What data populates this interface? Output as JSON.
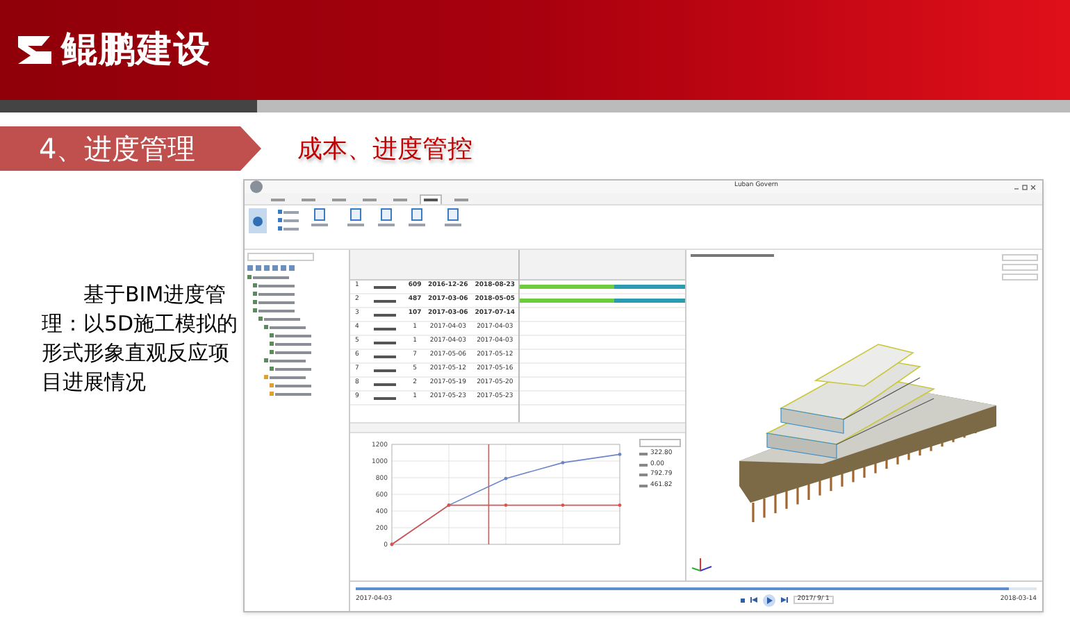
{
  "header": {
    "logo": "鲲鹏建设"
  },
  "section": {
    "title": "4、进度管理",
    "subtitle": "成本、进度管控"
  },
  "description": "基于BIM进度管理：以5D施工模拟的形式形象直观反应项目进展情况",
  "app": {
    "title": "Luban Govern",
    "checkboxes": [
      {
        "checked": true
      },
      {
        "checked": true
      },
      {
        "checked": true
      }
    ],
    "tabs": [
      {
        "selected": false
      },
      {
        "selected": false
      },
      {
        "selected": false
      },
      {
        "selected": false
      },
      {
        "selected": false
      },
      {
        "selected": true
      },
      {
        "selected": false
      }
    ],
    "gantt": {
      "rows": [
        {
          "number": "1",
          "duration": "609",
          "start": "2016-12-26",
          "end": "2018-08-23",
          "level": 0.57
        },
        {
          "number": "2",
          "duration": "487",
          "start": "2017-03-06",
          "end": "2018-05-05",
          "level": 0.57
        },
        {
          "number": "3",
          "duration": "107",
          "start": "2017-03-06",
          "end": "2017-07-14"
        },
        {
          "number": "4",
          "duration": "1",
          "start": "2017-04-03",
          "end": "2017-04-03"
        },
        {
          "number": "5",
          "duration": "1",
          "start": "2017-04-03",
          "end": "2017-04-03"
        },
        {
          "number": "6",
          "duration": "7",
          "start": "2017-05-06",
          "end": "2017-05-12"
        },
        {
          "number": "7",
          "duration": "5",
          "start": "2017-05-12",
          "end": "2017-05-16"
        },
        {
          "number": "8",
          "duration": "2",
          "start": "2017-05-19",
          "end": "2017-05-20"
        },
        {
          "number": "9",
          "duration": "1",
          "start": "2017-05-23",
          "end": "2017-05-23"
        }
      ]
    },
    "chart": {
      "chart_data": {
        "type": "line",
        "ylim": [
          0,
          1200
        ],
        "yticks": [
          0,
          200,
          400,
          600,
          800,
          1000,
          1200
        ],
        "grid": true,
        "series": [
          {
            "color": "#6b86c8",
            "values": [
              0,
              470,
              790,
              980,
              1080
            ]
          },
          {
            "color": "#d9534f",
            "values": [
              0,
              470,
              470,
              470,
              470
            ]
          }
        ]
      },
      "readings": [
        "322.80",
        "0.00",
        "792.79",
        "461.82"
      ]
    },
    "timeline": {
      "start": "2017-04-03",
      "date": "2017/ 9/ 1",
      "end": "2018-03-14",
      "level": 0.96
    }
  }
}
